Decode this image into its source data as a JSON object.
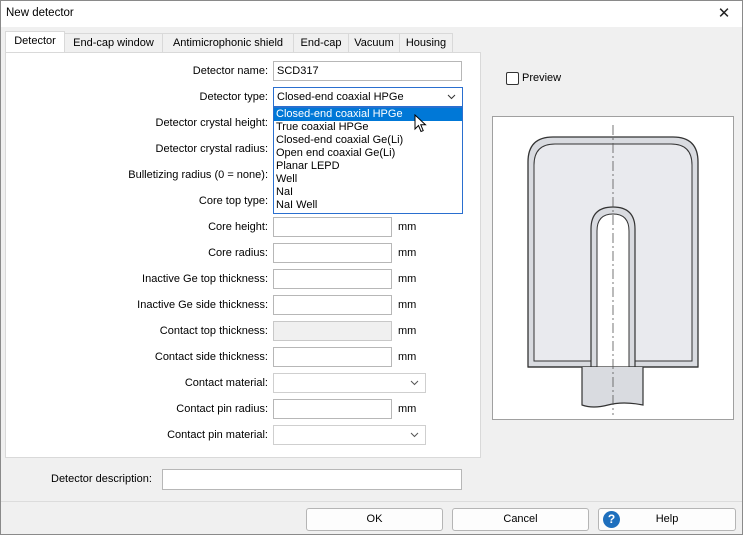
{
  "window": {
    "title": "New detector",
    "close_glyph": "✕"
  },
  "tabs": [
    {
      "label": "Detector",
      "active": true
    },
    {
      "label": "End-cap window",
      "active": false
    },
    {
      "label": "Antimicrophonic shield",
      "active": false
    },
    {
      "label": "End-cap",
      "active": false
    },
    {
      "label": "Vacuum",
      "active": false
    },
    {
      "label": "Housing",
      "active": false
    }
  ],
  "form": {
    "detector_name": {
      "label": "Detector name:",
      "value": "SCD317"
    },
    "detector_type": {
      "label": "Detector type:",
      "value": "Closed-end coaxial HPGe"
    },
    "crystal_height": {
      "label": "Detector crystal height:"
    },
    "crystal_radius": {
      "label": "Detector crystal radius:"
    },
    "bulletizing_radius": {
      "label": "Bulletizing radius (0 = none):"
    },
    "core_top_type": {
      "label": "Core top type:"
    },
    "core_height": {
      "label": "Core height:",
      "unit": "mm"
    },
    "core_radius": {
      "label": "Core radius:",
      "unit": "mm"
    },
    "inactive_top": {
      "label": "Inactive Ge top thickness:",
      "unit": "mm"
    },
    "inactive_side": {
      "label": "Inactive Ge side thickness:",
      "unit": "mm"
    },
    "contact_top": {
      "label": "Contact top thickness:",
      "unit": "mm"
    },
    "contact_side": {
      "label": "Contact side thickness:",
      "unit": "mm"
    },
    "contact_material": {
      "label": "Contact material:"
    },
    "pin_radius": {
      "label": "Contact pin radius:",
      "unit": "mm"
    },
    "pin_material": {
      "label": "Contact pin material:"
    }
  },
  "detector_type_options": [
    "Closed-end coaxial HPGe",
    "True coaxial HPGe",
    "Closed-end coaxial Ge(Li)",
    "Open end coaxial Ge(Li)",
    "Planar LEPD",
    "Well",
    "NaI",
    "NaI Well"
  ],
  "detector_type_selected_index": 0,
  "preview": {
    "label": "Preview",
    "checked": false
  },
  "description": {
    "label": "Detector description:",
    "value": ""
  },
  "buttons": {
    "ok": "OK",
    "cancel": "Cancel",
    "help": "Help",
    "help_glyph": "?"
  },
  "colors": {
    "selection": "#0078d7",
    "help_icon": "#1e6fbd"
  }
}
